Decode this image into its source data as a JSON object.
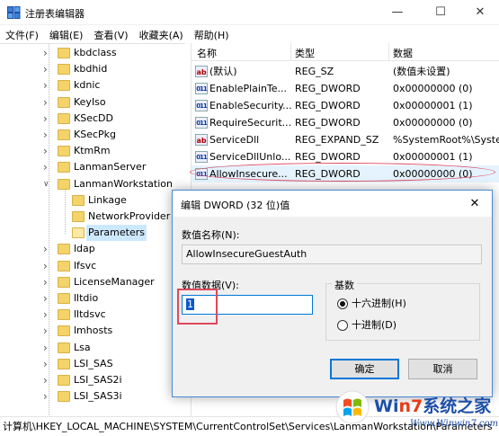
{
  "window": {
    "title": "注册表编辑器",
    "controls": {
      "minimize": "—",
      "maximize": "☐",
      "close": "✕"
    }
  },
  "menu": [
    "文件(F)",
    "编辑(E)",
    "查看(V)",
    "收藏夹(A)",
    "帮助(H)"
  ],
  "tree": {
    "items": [
      {
        "label": "kbdclass",
        "expandable": true
      },
      {
        "label": "kbdhid",
        "expandable": true
      },
      {
        "label": "kdnic",
        "expandable": true
      },
      {
        "label": "KeyIso",
        "expandable": true
      },
      {
        "label": "KSecDD",
        "expandable": true
      },
      {
        "label": "KSecPkg",
        "expandable": true
      },
      {
        "label": "KtmRm",
        "expandable": true
      },
      {
        "label": "LanmanServer",
        "expandable": true
      },
      {
        "label": "LanmanWorkstation",
        "expandable": true,
        "expanded": true
      },
      {
        "label": "Linkage",
        "child": true
      },
      {
        "label": "NetworkProvider",
        "child": true
      },
      {
        "label": "Parameters",
        "child": true,
        "selected": true
      },
      {
        "label": "ldap",
        "expandable": true
      },
      {
        "label": "lfsvc",
        "expandable": true
      },
      {
        "label": "LicenseManager",
        "expandable": true
      },
      {
        "label": "lltdio",
        "expandable": true
      },
      {
        "label": "lltdsvc",
        "expandable": true
      },
      {
        "label": "lmhosts",
        "expandable": true
      },
      {
        "label": "Lsa",
        "expandable": true
      },
      {
        "label": "LSI_SAS",
        "expandable": true
      },
      {
        "label": "LSI_SAS2i",
        "expandable": true
      },
      {
        "label": "LSI_SAS3i",
        "expandable": true
      }
    ]
  },
  "list": {
    "columns": {
      "name": "名称",
      "type": "类型",
      "data": "数据"
    },
    "rows": [
      {
        "icon": "ab",
        "name": "(默认)",
        "type": "REG_SZ",
        "data": "(数值未设置)"
      },
      {
        "icon": "bin",
        "name": "EnablePlainTe...",
        "type": "REG_DWORD",
        "data": "0x00000000 (0)"
      },
      {
        "icon": "bin",
        "name": "EnableSecurity...",
        "type": "REG_DWORD",
        "data": "0x00000001 (1)"
      },
      {
        "icon": "bin",
        "name": "RequireSecurit...",
        "type": "REG_DWORD",
        "data": "0x00000000 (0)"
      },
      {
        "icon": "ab",
        "name": "ServiceDll",
        "type": "REG_EXPAND_SZ",
        "data": "%SystemRoot%\\Syster"
      },
      {
        "icon": "bin",
        "name": "ServiceDllUnlo...",
        "type": "REG_DWORD",
        "data": "0x00000001 (1)"
      },
      {
        "icon": "bin",
        "name": "AllowInsecure...",
        "type": "REG_DWORD",
        "data": "0x00000000 (0)",
        "highlight": true
      }
    ]
  },
  "status": "计算机\\HKEY_LOCAL_MACHINE\\SYSTEM\\CurrentControlSet\\Services\\LanmanWorkstation\\Parameters",
  "dialog": {
    "title": "编辑 DWORD (32 位)值",
    "close": "✕",
    "name_label": "数值名称(N):",
    "name_value": "AllowInsecureGuestAuth",
    "data_label": "数值数据(V):",
    "data_value": "1",
    "base_label": "基数",
    "hex_label": "十六进制(H)",
    "dec_label": "十进制(D)",
    "hex_selected": true,
    "ok": "确定",
    "cancel": "取消"
  },
  "watermark": {
    "brand_a": "Wi",
    "brand_b": "n",
    "brand_seven": "7",
    "brand_cn": "系统之家",
    "url": "Www.Winwin7.com"
  }
}
